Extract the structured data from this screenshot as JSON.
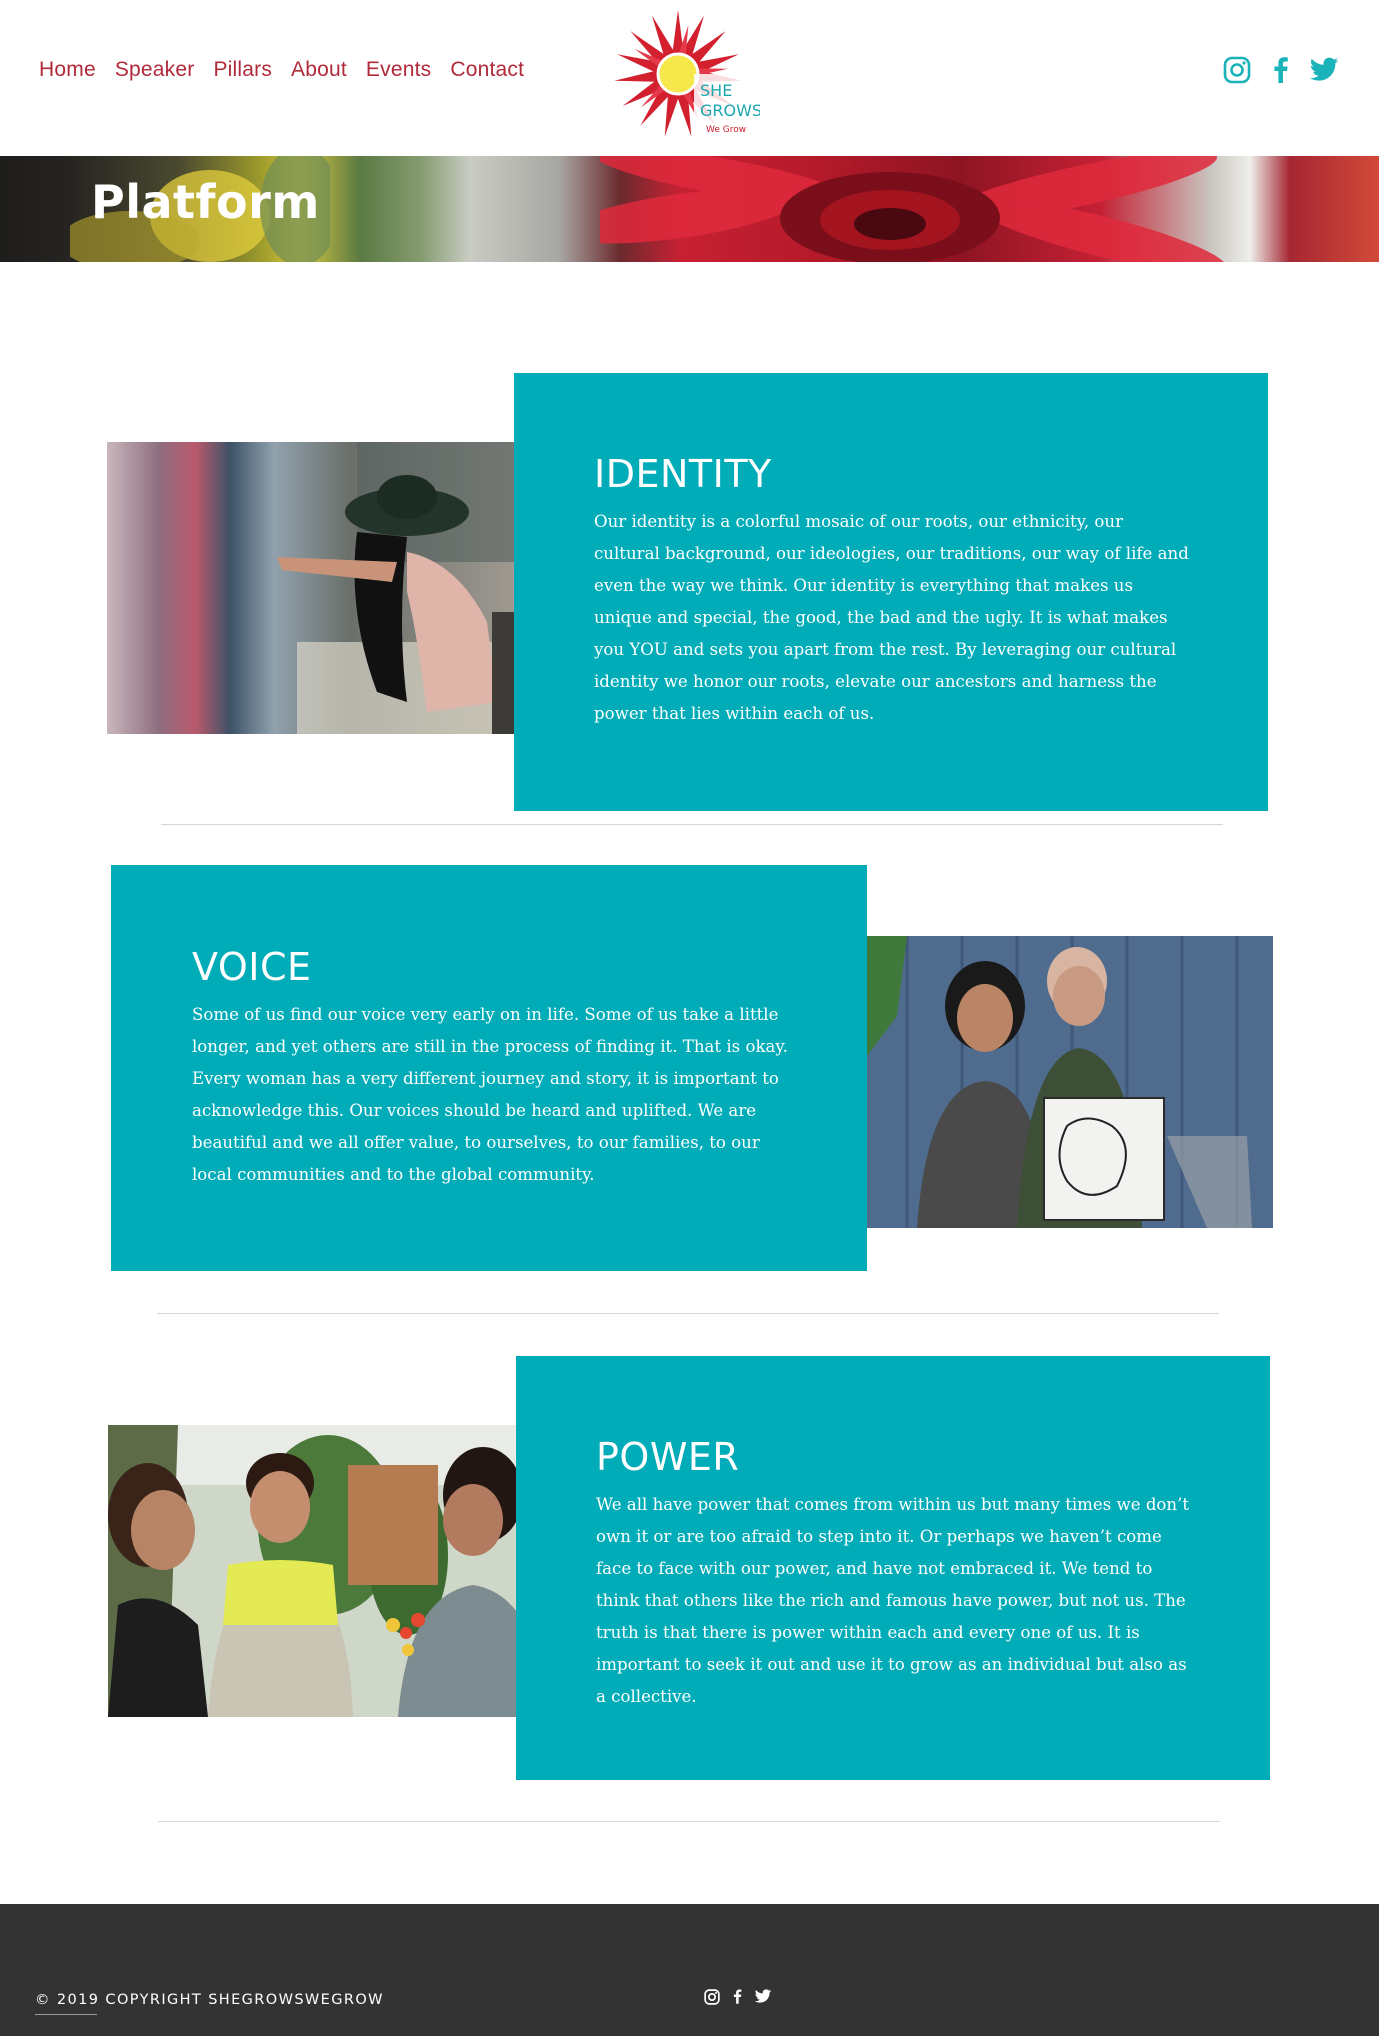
{
  "nav": {
    "items": [
      {
        "label": "Home"
      },
      {
        "label": "Speaker"
      },
      {
        "label": "Pillars"
      },
      {
        "label": "About"
      },
      {
        "label": "Events"
      },
      {
        "label": "Contact"
      }
    ]
  },
  "logo": {
    "line1": "SHE",
    "line2": "GROWS",
    "line3": "We Grow"
  },
  "social": [
    "instagram-icon",
    "facebook-icon",
    "twitter-icon"
  ],
  "banner": {
    "title": "Platform"
  },
  "sections": [
    {
      "title": "IDENTITY",
      "body": "Our identity is a colorful mosaic of our roots, our ethnicity, our cultural background, our ideologies, our traditions, our way of life and even the way we think. Our identity is everything that makes us unique and special, the good, the bad and the ugly. It is what makes you YOU and sets you apart from the rest. By leveraging our cultural identity we honor our roots, elevate our ancestors and harness the power that lies within each of us."
    },
    {
      "title": "VOICE",
      "body": "Some of us find our voice very early on in life. Some of us take a little longer, and yet others are still in the process of finding it. That is okay. Every woman has a very different journey and story, it is important to acknowledge this. Our voices should be heard and uplifted. We are beautiful and we all offer value, to ourselves, to our families, to our local communities and to the global community."
    },
    {
      "title": "POWER",
      "body": "We all have power that comes from within us but many times we don’t own it or are too afraid to step into it. Or perhaps we haven’t come face to face with our power, and have not embraced it. We tend to think that others like the rich and famous have power, but not us. The truth is that there is power within each and every one of us. It is important to seek it out and use it to grow as an individual but also as a collective."
    }
  ],
  "footer": {
    "copyright": "© 2019 COPYRIGHT SHEGROWSWEGROW"
  },
  "colors": {
    "teal": "#00acb8",
    "nav_red": "#b02a3a",
    "social_teal": "#19b3b9",
    "footer_bg": "#333333"
  }
}
